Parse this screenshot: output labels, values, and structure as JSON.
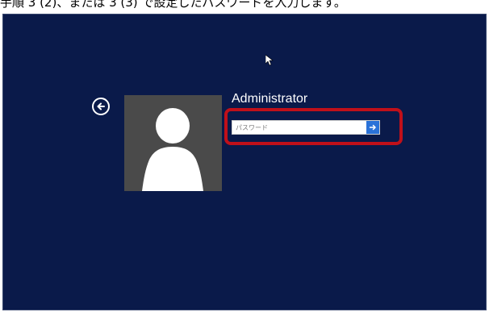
{
  "caption": {
    "text": "手順 3 (2)、または 3 (3) で設定したパスワードを入力します。"
  },
  "login": {
    "username": "Administrator",
    "password_placeholder": "パスワード",
    "password_value": ""
  },
  "icons": {
    "cursor": "mouse-pointer-icon",
    "back": "back-arrow-icon",
    "avatar": "user-silhouette-icon",
    "submit": "arrow-right-icon"
  },
  "colors": {
    "background": "#0a1a4a",
    "highlight": "#c0101a",
    "submit_button": "#2a72d8",
    "avatar_bg": "#4a4a4a"
  }
}
